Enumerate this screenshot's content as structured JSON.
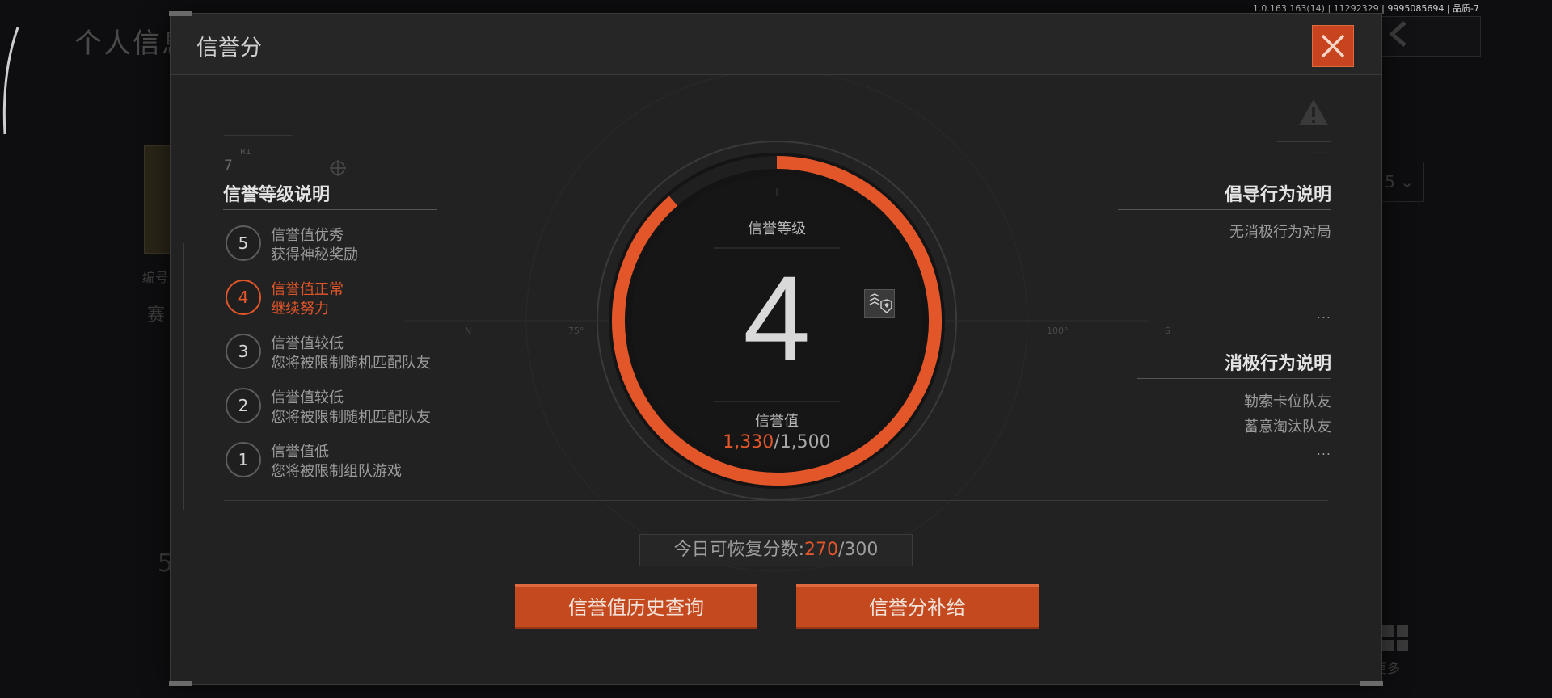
{
  "build_info": "1.0.163.163(14) | 11292329 | 9995085694 | 品质-7",
  "background": {
    "page_title": "个人信息",
    "left_text_a": "编号",
    "left_text_b": "赛",
    "left_number": "5",
    "dropdown_value": "5",
    "more_label": "更多"
  },
  "modal": {
    "title": "信誉分",
    "close_icon": "close-icon",
    "accent_color": "#e2562a"
  },
  "levels_panel": {
    "header": "信誉等级说明",
    "deco_number": "7",
    "deco_sup": "R1",
    "items": [
      {
        "level": "5",
        "line1": "信誉值优秀",
        "line2": "获得神秘奖励",
        "active": false
      },
      {
        "level": "4",
        "line1": "信誉值正常",
        "line2": "继续努力",
        "active": true
      },
      {
        "level": "3",
        "line1": "信誉值较低",
        "line2": "您将被限制随机匹配队友",
        "active": false
      },
      {
        "level": "2",
        "line1": "信誉值较低",
        "line2": "您将被限制随机匹配队友",
        "active": false
      },
      {
        "level": "1",
        "line1": "信誉值低",
        "line2": "您将被限制组队游戏",
        "active": false
      }
    ]
  },
  "dial": {
    "level_label": "信誉等级",
    "level": "4",
    "value_label": "信誉值",
    "current": "1,330",
    "max": "/1,500",
    "progress_fraction": 0.8867,
    "compass": [
      "N",
      "75°",
      "100°",
      "S"
    ]
  },
  "encouraged": {
    "header": "倡导行为说明",
    "items": [
      "无消极行为对局"
    ],
    "more": "..."
  },
  "negative": {
    "header": "消极行为说明",
    "items": [
      "勒索卡位队友",
      "蓄意淘汰队友"
    ],
    "more": "..."
  },
  "recover": {
    "label": "今日可恢复分数:",
    "current": "270",
    "max": "/300"
  },
  "buttons": {
    "history": "信誉值历史查询",
    "supply": "信誉分补给"
  }
}
